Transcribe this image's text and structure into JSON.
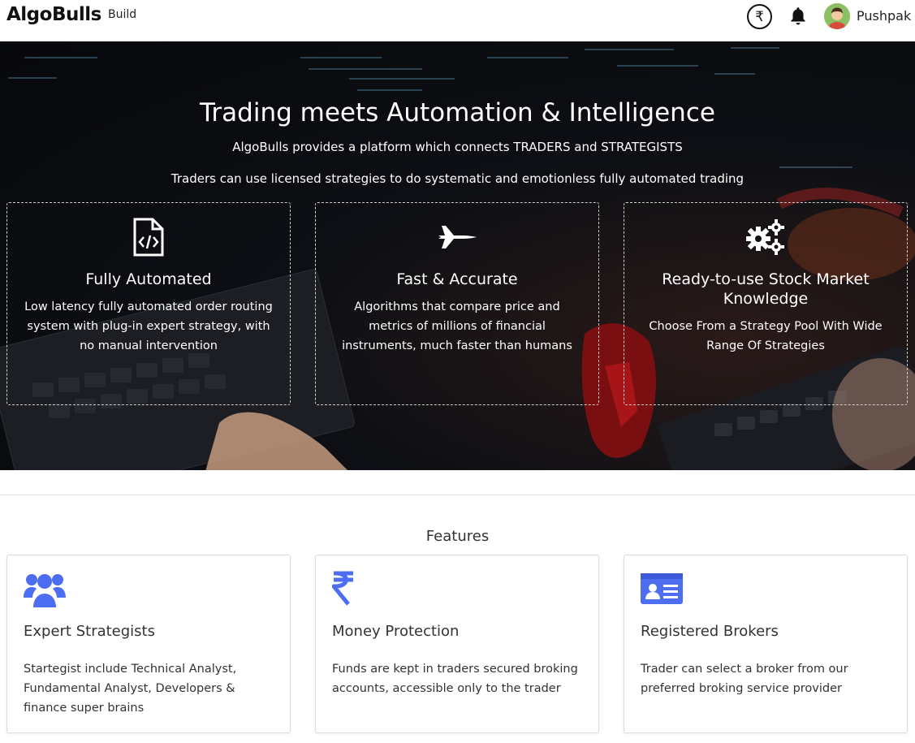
{
  "header": {
    "brand": "AlgoBulls",
    "nav_build": "Build",
    "rupee_symbol": "₹",
    "user_name": "Pushpak"
  },
  "hero": {
    "title": "Trading meets Automation & Intelligence",
    "subtitle": "AlgoBulls provides a platform which connects TRADERS and STRATEGISTS",
    "subtitle2": "Traders can use licensed strategies to do systematic and emotionless fully automated trading",
    "cards": [
      {
        "icon": "code-file-icon",
        "title": "Fully Automated",
        "description": "Low latency fully automated order routing system with plug-in expert strategy, with no manual intervention"
      },
      {
        "icon": "fighter-jet-icon",
        "title": "Fast & Accurate",
        "description": "Algorithms that compare price and metrics of millions of financial instruments, much faster than humans"
      },
      {
        "icon": "gears-icon",
        "title": "Ready-to-use Stock Market Knowledge",
        "description": "Choose From a Strategy Pool With Wide Range Of Strategies"
      }
    ]
  },
  "features": {
    "title": "Features",
    "accent_color": "#4e6ef2",
    "cards": [
      {
        "icon": "users-icon",
        "title": "Expert Strategists",
        "description": "Startegist include Technical Analyst, Fundamental Analyst, Developers & finance super brains"
      },
      {
        "icon": "rupee-icon",
        "title": "Money Protection",
        "description": "Funds are kept in traders secured broking accounts, accessible only to the trader"
      },
      {
        "icon": "id-card-icon",
        "title": "Registered Brokers",
        "description": "Trader can select a broker from our preferred broking service provider"
      }
    ]
  }
}
